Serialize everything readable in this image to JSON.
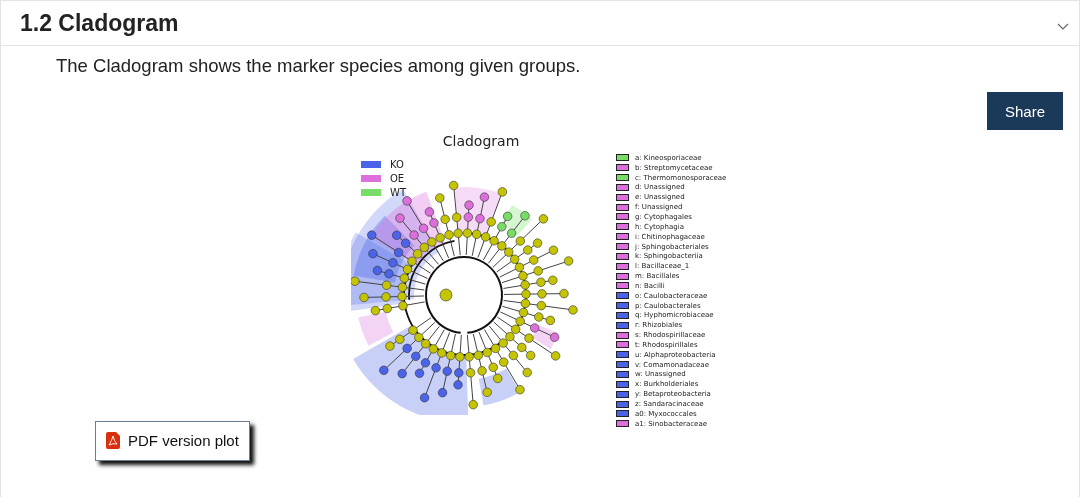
{
  "section": {
    "title": "1.2 Cladogram",
    "expanded": true
  },
  "description": "The Cladogram shows the marker species among given groups.",
  "share_button": "Share",
  "figure": {
    "title": "Cladogram",
    "groups": [
      {
        "label": "KO",
        "color": "#4a63e8"
      },
      {
        "label": "OE",
        "color": "#dc6fdc"
      },
      {
        "label": "WT",
        "color": "#77dd66"
      }
    ],
    "taxa": [
      {
        "label": "a: Kineosporiaceae",
        "color": "#77dd66"
      },
      {
        "label": "b: Streptomycetaceae",
        "color": "#dc6fdc"
      },
      {
        "label": "c: Thermomonosporaceae",
        "color": "#77dd66"
      },
      {
        "label": "d: Unassigned",
        "color": "#dc6fdc"
      },
      {
        "label": "e: Unassigned",
        "color": "#dc6fdc"
      },
      {
        "label": "f: Unassigned",
        "color": "#dc6fdc"
      },
      {
        "label": "g: Cytophagales",
        "color": "#dc6fdc"
      },
      {
        "label": "h: Cytophagia",
        "color": "#dc6fdc"
      },
      {
        "label": "i: Chitinophagaceae",
        "color": "#dc6fdc"
      },
      {
        "label": "j: Sphingobacteriales",
        "color": "#dc6fdc"
      },
      {
        "label": "k: Sphingobacteriia",
        "color": "#dc6fdc"
      },
      {
        "label": "l: Bacillaceae_1",
        "color": "#dc6fdc"
      },
      {
        "label": "m: Bacillales",
        "color": "#dc6fdc"
      },
      {
        "label": "n: Bacilli",
        "color": "#dc6fdc"
      },
      {
        "label": "o: Caulobacteraceae",
        "color": "#4a63e8"
      },
      {
        "label": "p: Caulobacterales",
        "color": "#4a63e8"
      },
      {
        "label": "q: Hyphomicrobiaceae",
        "color": "#4a63e8"
      },
      {
        "label": "r: Rhizobiales",
        "color": "#4a63e8"
      },
      {
        "label": "s: Rhodospirillaceae",
        "color": "#dc6fdc"
      },
      {
        "label": "t: Rhodospirillales",
        "color": "#dc6fdc"
      },
      {
        "label": "u: Alphaproteobacteria",
        "color": "#4a63e8"
      },
      {
        "label": "v: Comamonadaceae",
        "color": "#4a63e8"
      },
      {
        "label": "w: Unassigned",
        "color": "#4a63e8"
      },
      {
        "label": "x: Burkholderiales",
        "color": "#4a63e8"
      },
      {
        "label": "y: Betaproteobacteria",
        "color": "#4a63e8"
      },
      {
        "label": "z: Sandaracinaceae",
        "color": "#4a63e8"
      },
      {
        "label": "a0: Myxococcales",
        "color": "#4a63e8"
      },
      {
        "label": "a1: Sinobacteraceae",
        "color": "#dc6fdc"
      }
    ]
  },
  "pdf_button": "PDF version plot"
}
